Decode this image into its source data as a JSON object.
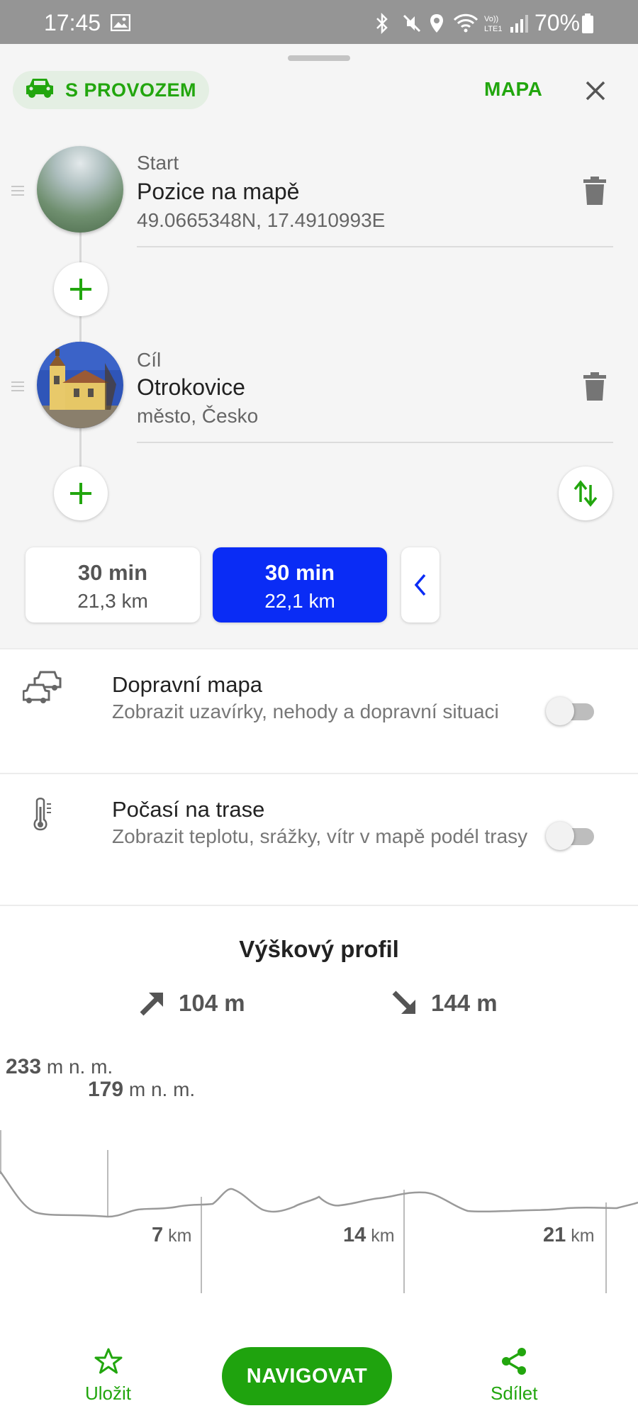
{
  "status_bar": {
    "time": "17:45",
    "battery": "70%"
  },
  "header": {
    "mode_label": "S PROVOZEM",
    "map_label": "MAPA"
  },
  "waypoints": [
    {
      "label": "Start",
      "title": "Pozice na mapě",
      "subtitle": "49.0665348N, 17.4910993E"
    },
    {
      "label": "Cíl",
      "title": "Otrokovice",
      "subtitle": "město, Česko"
    }
  ],
  "routes": [
    {
      "time": "30 min",
      "distance": "21,3 km",
      "selected": false
    },
    {
      "time": "30 min",
      "distance": "22,1 km",
      "selected": true
    }
  ],
  "options": [
    {
      "title": "Dopravní mapa",
      "subtitle": "Zobrazit uzavírky, nehody a dopravní situaci",
      "enabled": false
    },
    {
      "title": "Počasí na trase",
      "subtitle": "Zobrazit teplotu, srážky, vítr v mapě podél trasy",
      "enabled": false
    }
  ],
  "elevation": {
    "title": "Výškový profil",
    "ascent": "104 m",
    "descent": "144 m",
    "max_value": "233",
    "min_value": "179",
    "unit_label": "m n. m.",
    "km_unit": "km",
    "km_ticks": [
      "7",
      "14",
      "21"
    ]
  },
  "bottom_bar": {
    "save_label": "Uložit",
    "navigate_label": "NAVIGOVAT",
    "share_label": "Sdílet"
  },
  "colors": {
    "brand_green": "#22a60e",
    "selected_route_blue": "#0a2cf5"
  }
}
